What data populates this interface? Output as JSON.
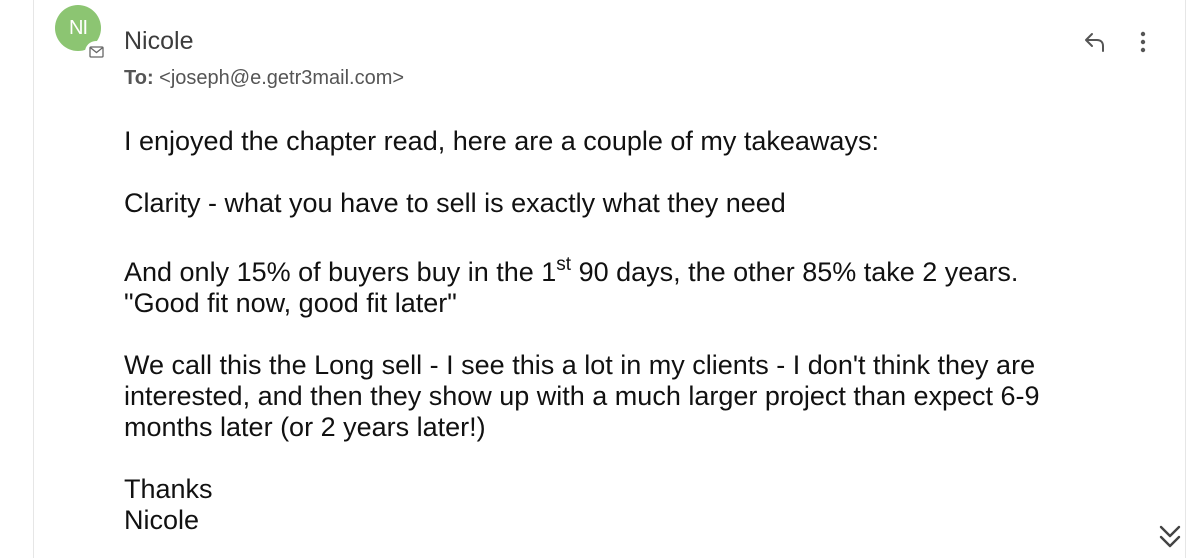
{
  "sender": {
    "initials": "NI",
    "name": "Nicole"
  },
  "recipient": {
    "to_label": "To:",
    "address": "<joseph@e.getr3mail.com>"
  },
  "actions": {
    "reply_icon": "reply-icon",
    "more_icon": "more-vertical-icon",
    "expand_icon": "double-chevron-down-icon"
  },
  "message": {
    "line1": "I enjoyed the chapter read, here are a couple of my takeaways:",
    "line2": "Clarity - what you have to sell is exactly what they need",
    "line3_a": "And only 15% of buyers buy in the 1",
    "line3_sup": "st",
    "line3_b": " 90 days, the other 85% take 2 years.",
    "line4": "\"Good fit now, good fit later\"",
    "line5": "We call this the Long sell - I see this a lot in my clients - I don't think they are",
    "line6": "interested, and then they show up with a much larger project than expect 6-9",
    "line7": "months later (or 2 years later!)",
    "closing": "Thanks",
    "signature": "Nicole"
  },
  "colors": {
    "avatar_bg": "#8cc572",
    "text": "#111111",
    "muted": "#555555"
  }
}
